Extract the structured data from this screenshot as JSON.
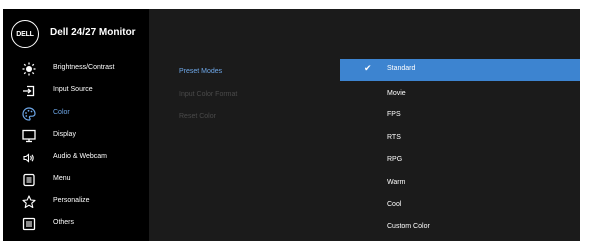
{
  "header": {
    "brand_logo": "DELL",
    "model": "Dell 24/27 Monitor"
  },
  "sidebar": {
    "items": [
      {
        "label": "Brightness/Contrast",
        "icon": "brightness-icon"
      },
      {
        "label": "Input Source",
        "icon": "input-source-icon"
      },
      {
        "label": "Color",
        "icon": "color-palette-icon",
        "active": true
      },
      {
        "label": "Display",
        "icon": "display-icon"
      },
      {
        "label": "Audio & Webcam",
        "icon": "speaker-icon"
      },
      {
        "label": "Menu",
        "icon": "menu-icon"
      },
      {
        "label": "Personalize",
        "icon": "star-icon"
      },
      {
        "label": "Others",
        "icon": "others-icon"
      }
    ]
  },
  "submenu": {
    "items": [
      {
        "label": "Preset Modes",
        "state": "active"
      },
      {
        "label": "Input Color Format",
        "state": "disabled"
      },
      {
        "label": "Reset Color",
        "state": "disabled"
      }
    ]
  },
  "options": {
    "items": [
      {
        "label": "Standard",
        "selected": true
      },
      {
        "label": "Movie"
      },
      {
        "label": "FPS"
      },
      {
        "label": "RTS"
      },
      {
        "label": "RPG"
      },
      {
        "label": "Warm"
      },
      {
        "label": "Cool"
      },
      {
        "label": "Custom Color"
      }
    ]
  },
  "colors": {
    "accent": "#3d84d0",
    "active_text": "#6ea7e8",
    "disabled_text": "#4a4a4a",
    "sidebar_bg": "#000000",
    "panel_bg": "#1b1b1b"
  }
}
